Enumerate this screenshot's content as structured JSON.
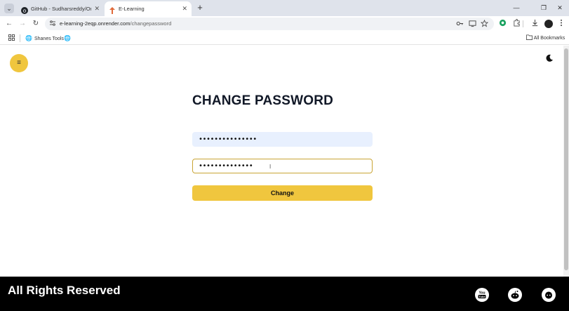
{
  "browser": {
    "tabs": [
      {
        "title": "GitHub - Sudharsreddy/OnlineL",
        "favicon": "github-icon",
        "active": false
      },
      {
        "title": "E-Learning",
        "favicon": "elearning-favicon",
        "active": true
      }
    ],
    "tab_list_glyph": "⌄",
    "tab_close_glyph": "✕",
    "new_tab_glyph": "+",
    "window_controls": {
      "minimize": "—",
      "restore": "❐",
      "close": "✕"
    },
    "nav": {
      "back": "←",
      "forward": "→",
      "reload": "↻"
    },
    "address": {
      "host": "e-learning-2eqp.onrender.com",
      "path": "/changepassword"
    },
    "bookmarks": [
      {
        "label": "Shanes Tools",
        "icon": "globe-icon"
      },
      {
        "label": "",
        "icon": "globe-icon"
      }
    ],
    "all_bookmarks_label": "All Bookmarks"
  },
  "page": {
    "menu_glyph": "≡",
    "title": "CHANGE PASSWORD",
    "password_1_value": "•••••••••••••••",
    "password_2_value": "••••••••••••••",
    "cursor_glyph": "I",
    "button_label": "Change",
    "footer_text": "All Rights Reserved"
  },
  "colors": {
    "accent": "#f0c63e",
    "autofill": "#e8f0fe",
    "focus_border": "#c9a434",
    "footer_bg": "#000000"
  }
}
